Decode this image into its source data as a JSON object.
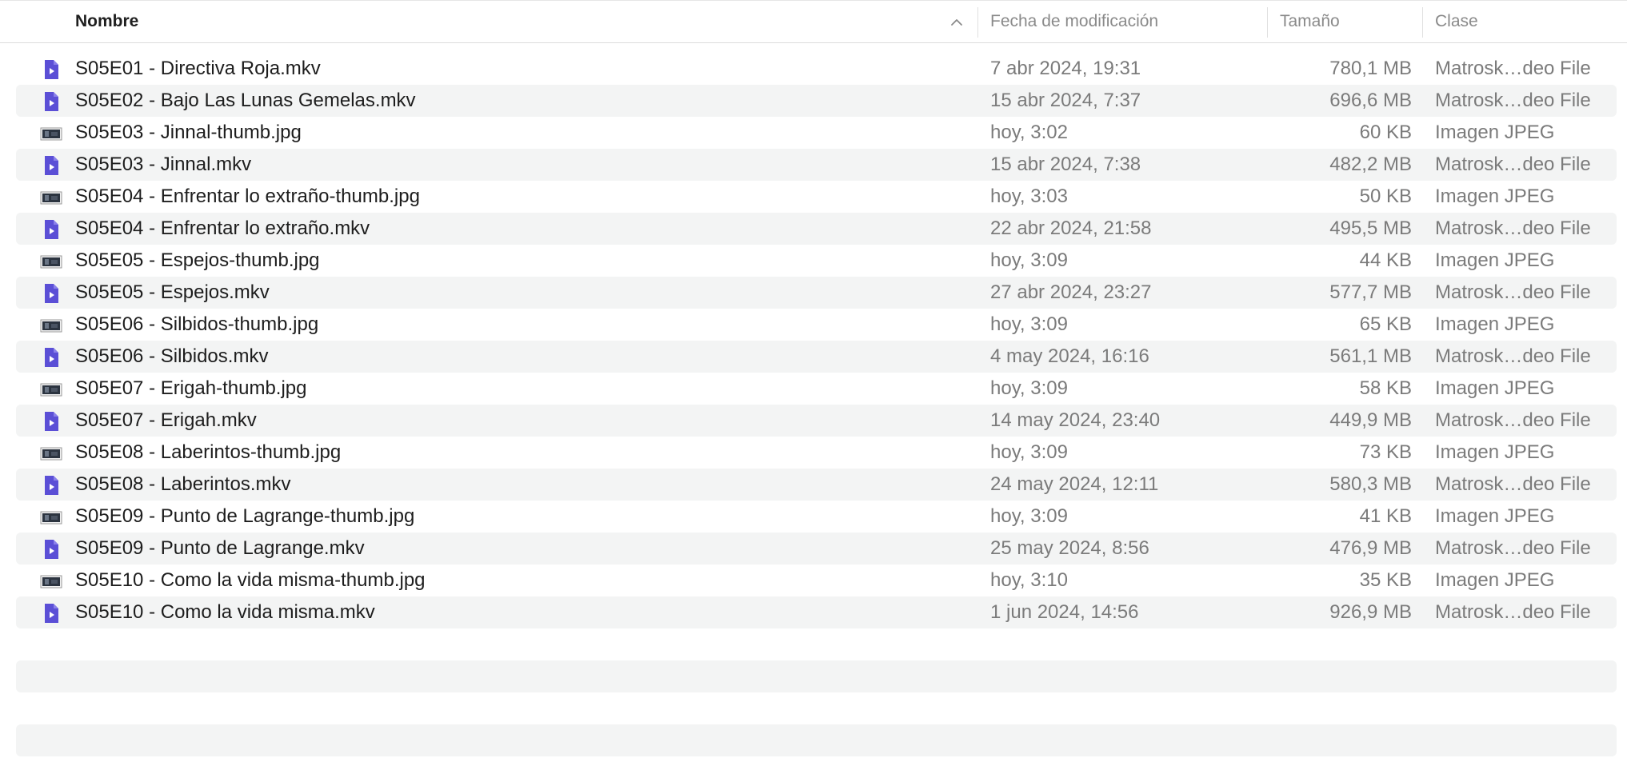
{
  "columns": {
    "name": "Nombre",
    "date": "Fecha de modificación",
    "size": "Tamaño",
    "kind": "Clase"
  },
  "sort": {
    "column": "Nombre",
    "direction": "ascending",
    "icon": "chevron-up-icon"
  },
  "colors": {
    "mkv_icon": "#5b4fd6",
    "alt_row": "#f3f4f4"
  },
  "files": [
    {
      "name": "S05E01 - Directiva Roja.mkv",
      "date": "7 abr 2024, 19:31",
      "size": "780,1 MB",
      "kind": "Matrosk…deo File",
      "icon": "mkv-file-icon"
    },
    {
      "name": "S05E02 - Bajo Las Lunas Gemelas.mkv",
      "date": "15 abr 2024, 7:37",
      "size": "696,6 MB",
      "kind": "Matrosk…deo File",
      "icon": "mkv-file-icon"
    },
    {
      "name": "S05E03 - Jinnal-thumb.jpg",
      "date": "hoy, 3:02",
      "size": "60 KB",
      "kind": "Imagen JPEG",
      "icon": "jpeg-thumbnail-icon"
    },
    {
      "name": "S05E03 - Jinnal.mkv",
      "date": "15 abr 2024, 7:38",
      "size": "482,2 MB",
      "kind": "Matrosk…deo File",
      "icon": "mkv-file-icon"
    },
    {
      "name": "S05E04 - Enfrentar lo extraño-thumb.jpg",
      "date": "hoy, 3:03",
      "size": "50 KB",
      "kind": "Imagen JPEG",
      "icon": "jpeg-thumbnail-icon"
    },
    {
      "name": "S05E04 - Enfrentar lo extraño.mkv",
      "date": "22 abr 2024, 21:58",
      "size": "495,5 MB",
      "kind": "Matrosk…deo File",
      "icon": "mkv-file-icon"
    },
    {
      "name": "S05E05 - Espejos-thumb.jpg",
      "date": "hoy, 3:09",
      "size": "44 KB",
      "kind": "Imagen JPEG",
      "icon": "jpeg-thumbnail-icon"
    },
    {
      "name": "S05E05 - Espejos.mkv",
      "date": "27 abr 2024, 23:27",
      "size": "577,7 MB",
      "kind": "Matrosk…deo File",
      "icon": "mkv-file-icon"
    },
    {
      "name": "S05E06 - Silbidos-thumb.jpg",
      "date": "hoy, 3:09",
      "size": "65 KB",
      "kind": "Imagen JPEG",
      "icon": "jpeg-thumbnail-icon"
    },
    {
      "name": "S05E06 - Silbidos.mkv",
      "date": "4 may 2024, 16:16",
      "size": "561,1 MB",
      "kind": "Matrosk…deo File",
      "icon": "mkv-file-icon"
    },
    {
      "name": "S05E07 - Erigah-thumb.jpg",
      "date": "hoy, 3:09",
      "size": "58 KB",
      "kind": "Imagen JPEG",
      "icon": "jpeg-thumbnail-icon"
    },
    {
      "name": "S05E07 - Erigah.mkv",
      "date": "14 may 2024, 23:40",
      "size": "449,9 MB",
      "kind": "Matrosk…deo File",
      "icon": "mkv-file-icon"
    },
    {
      "name": "S05E08 - Laberintos-thumb.jpg",
      "date": "hoy, 3:09",
      "size": "73 KB",
      "kind": "Imagen JPEG",
      "icon": "jpeg-thumbnail-icon"
    },
    {
      "name": "S05E08 - Laberintos.mkv",
      "date": "24 may 2024, 12:11",
      "size": "580,3 MB",
      "kind": "Matrosk…deo File",
      "icon": "mkv-file-icon"
    },
    {
      "name": "S05E09 - Punto de Lagrange-thumb.jpg",
      "date": "hoy, 3:09",
      "size": "41 KB",
      "kind": "Imagen JPEG",
      "icon": "jpeg-thumbnail-icon"
    },
    {
      "name": "S05E09 - Punto de Lagrange.mkv",
      "date": "25 may 2024, 8:56",
      "size": "476,9 MB",
      "kind": "Matrosk…deo File",
      "icon": "mkv-file-icon"
    },
    {
      "name": "S05E10 - Como la vida misma-thumb.jpg",
      "date": "hoy, 3:10",
      "size": "35 KB",
      "kind": "Imagen JPEG",
      "icon": "jpeg-thumbnail-icon"
    },
    {
      "name": "S05E10 - Como la vida misma.mkv",
      "date": "1 jun 2024, 14:56",
      "size": "926,9 MB",
      "kind": "Matrosk…deo File",
      "icon": "mkv-file-icon"
    }
  ]
}
